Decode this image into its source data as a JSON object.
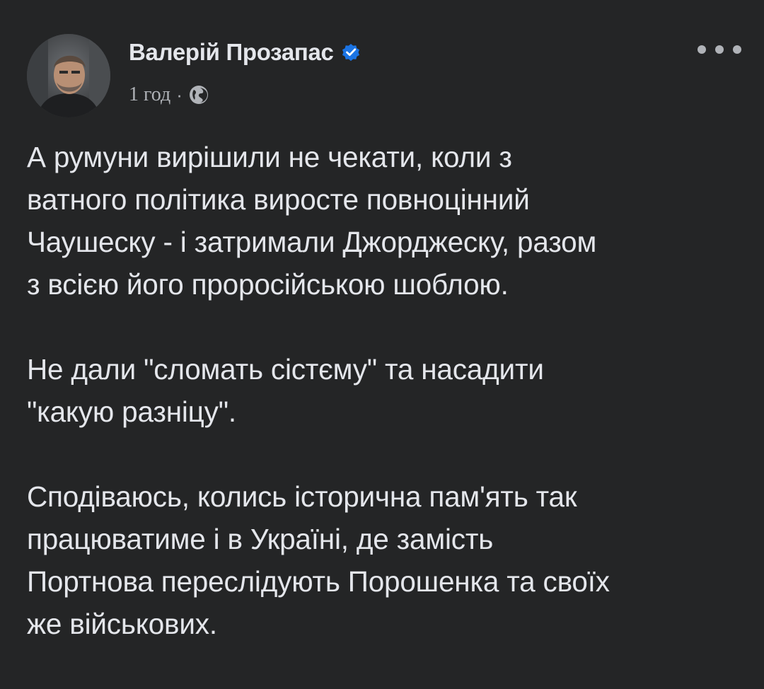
{
  "post": {
    "author": {
      "name": "Валерій Прозапас",
      "verified": true,
      "avatar_icon": "user-photo-avatar"
    },
    "meta": {
      "time": "1 год",
      "separator": "·",
      "audience_icon": "globe-icon"
    },
    "menu_icon": "more-options-icon",
    "paragraphs": [
      {
        "lines": [
          "А румуни вирішили не чекати, коли з",
          "ватного політика виросте повноцінний",
          "Чаушеску - і затримали Джорджеску, разом",
          "з всією його проросійською шоблою."
        ]
      },
      {
        "lines": [
          "Не дали \"сломать сістєму\" та насадити",
          "\"какую разніцу\"."
        ]
      },
      {
        "lines": [
          "Сподіваюсь, колись історична пам'ять так",
          "працюватиме і в Україні, де замість",
          "Портнова переслідують Порошенка та своїх",
          "же військових."
        ]
      }
    ]
  },
  "colors": {
    "background": "#242526",
    "primary_text": "#E4E6EB",
    "secondary_text": "#B0B3B8",
    "verified_badge": "#1B74E4"
  }
}
